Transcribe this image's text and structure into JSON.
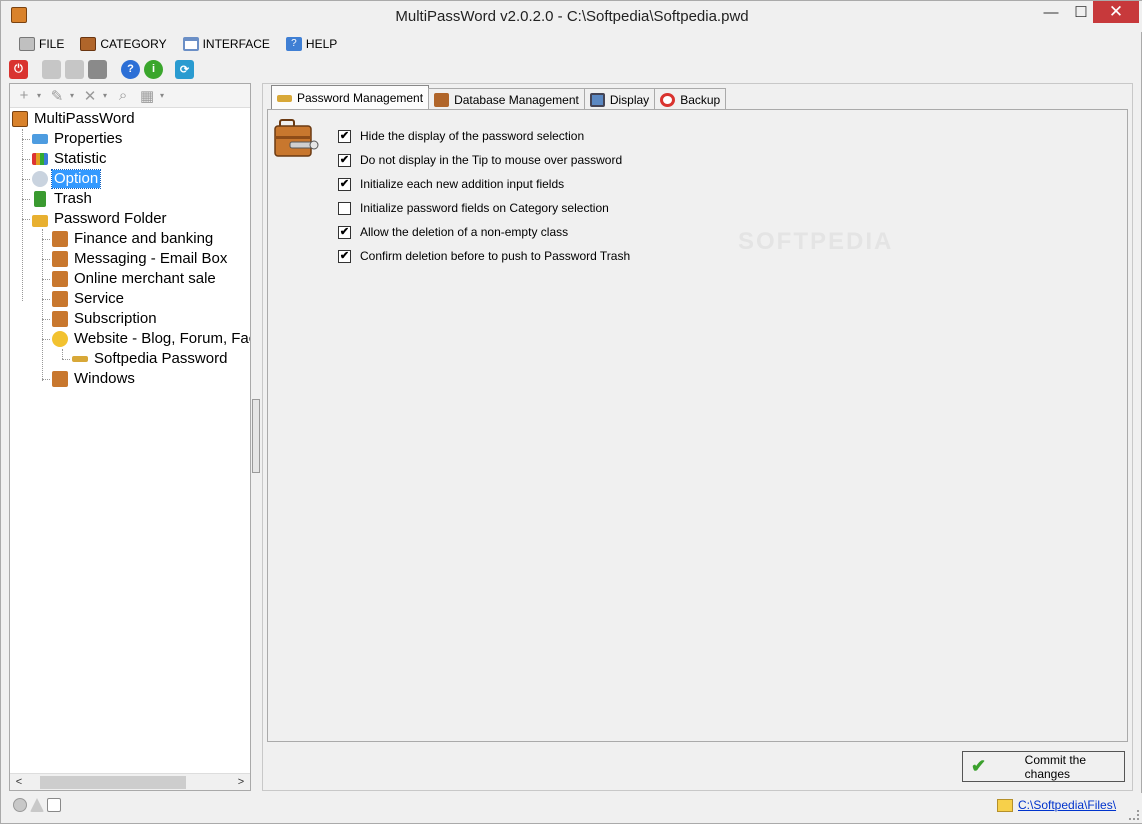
{
  "window": {
    "title": "MultiPassWord v2.0.2.0 - C:\\Softpedia\\Softpedia.pwd",
    "controls": {
      "minimize": "—",
      "maximize": "☐",
      "close": "✕"
    }
  },
  "menu": {
    "items": [
      {
        "label": "FILE",
        "icon": "file-icon",
        "color": "#c0c0c0"
      },
      {
        "label": "CATEGORY",
        "icon": "briefcase-icon",
        "color": "#b0652a"
      },
      {
        "label": "INTERFACE",
        "icon": "window-icon",
        "color": "#6b8fc6"
      },
      {
        "label": "HELP",
        "icon": "help-icon",
        "color": "#3f7fd4"
      }
    ]
  },
  "toolbar": {
    "items": [
      {
        "name": "power-icon",
        "glyph": "⏻",
        "color": "#d9332f"
      },
      {
        "name": "print-icon",
        "glyph": "",
        "color": "#b8b8b8"
      },
      {
        "name": "print-preview-icon",
        "glyph": "",
        "color": "#b8b8b8"
      },
      {
        "name": "export-icon",
        "glyph": "",
        "color": "#888888"
      },
      {
        "name": "help-icon",
        "glyph": "?",
        "color": "#2c6fd6"
      },
      {
        "name": "info-icon",
        "glyph": "i",
        "color": "#3aa62c"
      },
      {
        "name": "refresh-icon",
        "glyph": "⟳",
        "color": "#2a9bd0"
      }
    ]
  },
  "tree_toolbar": {
    "add": "+",
    "edit": "✎",
    "delete": "✕",
    "find": "⌕",
    "grid": "▦",
    "dropdown": "▾"
  },
  "tree": {
    "root": "MultiPassWord",
    "items": [
      {
        "label": "Properties",
        "icon": "properties-icon",
        "color": "#4d9ce0"
      },
      {
        "label": "Statistic",
        "icon": "statistic-icon",
        "color": "#e0a020"
      },
      {
        "label": "Option",
        "icon": "option-icon",
        "color": "#8aa0b8",
        "selected": true
      },
      {
        "label": "Trash",
        "icon": "trash-icon",
        "color": "#3a9a30"
      },
      {
        "label": "Password Folder",
        "icon": "lock-icon",
        "color": "#e8b030"
      }
    ],
    "folders": [
      {
        "label": "Finance and banking",
        "icon": "briefcase-icon",
        "color": "#c8772e"
      },
      {
        "label": "Messaging - Email Box",
        "icon": "briefcase-icon",
        "color": "#c8772e"
      },
      {
        "label": "Online merchant sale",
        "icon": "briefcase-icon",
        "color": "#c8772e"
      },
      {
        "label": "Service",
        "icon": "briefcase-icon",
        "color": "#c8772e"
      },
      {
        "label": "Subscription",
        "icon": "briefcase-icon",
        "color": "#c8772e"
      },
      {
        "label": "Website - Blog, Forum, Fac",
        "icon": "globe-icon",
        "color": "#f2c230"
      },
      {
        "label": "Windows",
        "icon": "briefcase-icon",
        "color": "#c8772e"
      }
    ],
    "password_entry": {
      "label": "Softpedia Password",
      "icon": "key-icon",
      "color": "#d8a838"
    }
  },
  "tabs": [
    {
      "label": "Password Management",
      "icon": "key-icon",
      "color": "#d8a838",
      "active": true
    },
    {
      "label": "Database Management",
      "icon": "database-icon",
      "color": "#b0652a"
    },
    {
      "label": "Display",
      "icon": "display-icon",
      "color": "#5b88c2"
    },
    {
      "label": "Backup",
      "icon": "lifebuoy-icon",
      "color": "#d9332f"
    }
  ],
  "options": [
    {
      "label": "Hide the display of the password selection",
      "checked": true
    },
    {
      "label": "Do not display in the Tip to mouse over password",
      "checked": true
    },
    {
      "label": "Initialize each new addition input fields",
      "checked": true
    },
    {
      "label": "Initialize password fields on Category selection",
      "checked": false
    },
    {
      "label": "Allow the deletion of a non-empty class",
      "checked": true
    },
    {
      "label": "Confirm deletion before to push to Password Trash",
      "checked": true
    }
  ],
  "commit": {
    "label": "Commit the changes",
    "check": "✔"
  },
  "statusbar": {
    "path": "C:\\Softpedia\\Files\\",
    "icons": [
      "info-icon",
      "warning-icon",
      "message-icon"
    ]
  },
  "scroll": {
    "left": "<",
    "right": ">"
  },
  "watermark": "SOFTPEDIA"
}
